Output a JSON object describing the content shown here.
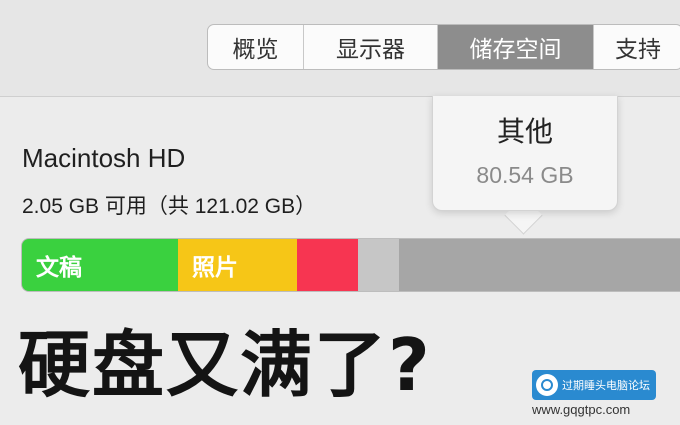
{
  "tabs": [
    {
      "label": "概览",
      "active": false
    },
    {
      "label": "显示器",
      "active": false
    },
    {
      "label": "储存空间",
      "active": true
    },
    {
      "label": "支持",
      "active": false
    }
  ],
  "disk": {
    "name": "Macintosh HD",
    "free_text": "2.05 GB 可用（共 121.02 GB）"
  },
  "tooltip": {
    "title": "其他",
    "value": "80.54 GB"
  },
  "storage_bar": {
    "segments": [
      {
        "label": "文稿",
        "color": "#3ad13f"
      },
      {
        "label": "照片",
        "color": "#f6c617"
      },
      {
        "label": "",
        "color": "#f73551"
      },
      {
        "label": "",
        "color": "#c6c6c6"
      },
      {
        "label": "",
        "color": "#a6a6a6"
      }
    ]
  },
  "headline": "硬盘又满了?",
  "watermark": {
    "name": "过期睡头电脑论坛",
    "url": "www.gqgtpc.com"
  }
}
